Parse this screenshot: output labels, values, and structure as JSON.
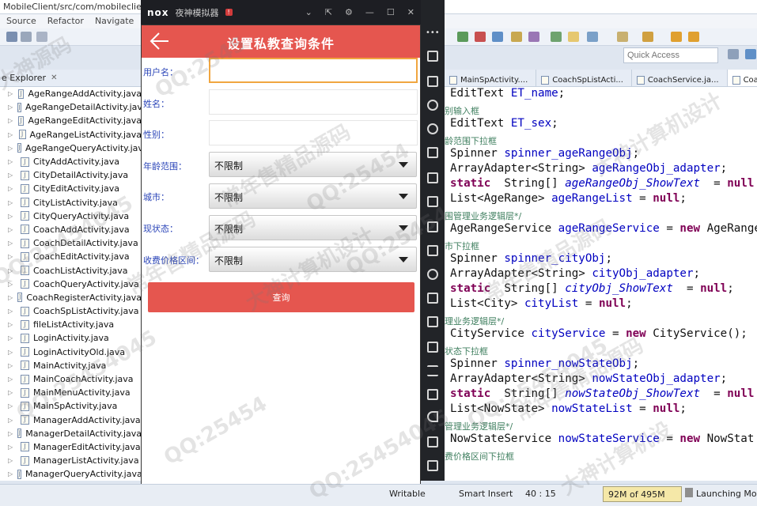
{
  "ide": {
    "title": "MobileClient/src/com/mobileclient/a",
    "menu": [
      "Source",
      "Refactor",
      "Navigate",
      "Se"
    ],
    "quick_access_placeholder": "Quick Access"
  },
  "explorer": {
    "title": "e Explorer",
    "close": "✕",
    "files": [
      "AgeRangeAddActivity.java",
      "AgeRangeDetailActivity.java",
      "AgeRangeEditActivity.java",
      "AgeRangeListActivity.java",
      "AgeRangeQueryActivity.java",
      "CityAddActivity.java",
      "CityDetailActivity.java",
      "CityEditActivity.java",
      "CityListActivity.java",
      "CityQueryActivity.java",
      "CoachAddActivity.java",
      "CoachDetailActivity.java",
      "CoachEditActivity.java",
      "CoachListActivity.java",
      "CoachQueryActivity.java",
      "CoachRegisterActivity.java",
      "CoachSpListActivity.java",
      "fileListActivity.java",
      "LoginActivity.java",
      "LoginActivityOld.java",
      "MainActivity.java",
      "MainCoachActivity.java",
      "MainMenuActivity.java",
      "MainSpActivity.java",
      "ManagerAddActivity.java",
      "ManagerDetailActivity.java",
      "ManagerEditActivity.java",
      "ManagerListActivity.java",
      "ManagerQueryActivity.java"
    ]
  },
  "emulator": {
    "logo": "nox",
    "name": "夜神模拟器",
    "badge": "!"
  },
  "app": {
    "title": "设置私教查询条件",
    "labels": {
      "username": "用户名：",
      "name": "姓名：",
      "sex": "性别：",
      "age_range": "年龄范围：",
      "city": "城市：",
      "now_state": "现状态：",
      "price_range": "收费价格区间："
    },
    "spinners": {
      "age_range": "不限制",
      "city": "不限制",
      "now_state": "不限制",
      "price_range": "不限制"
    },
    "query_button": "查询"
  },
  "editor": {
    "tabs": [
      "MainSpActivity....",
      "CoachSpListActi...",
      "CoachService.ja...",
      "Coach"
    ],
    "lines": [
      {
        "type": "code",
        "text": "EditText ET_name;"
      },
      {
        "type": "comment",
        "text": "别输入框"
      },
      {
        "type": "code",
        "text": "EditText ET_sex;"
      },
      {
        "type": "comment",
        "text": "龄范围下拉框"
      },
      {
        "type": "code",
        "text": "Spinner spinner_ageRangeObj;"
      },
      {
        "type": "code",
        "text": "ArrayAdapter<String> ageRangeObj_adapter;"
      },
      {
        "type": "code",
        "text": "static  String[] ageRangeObj_ShowText  = null"
      },
      {
        "type": "code",
        "text": "List<AgeRange> ageRangeList = null;"
      },
      {
        "type": "comment",
        "text": "围管理业务逻辑层*/"
      },
      {
        "type": "code",
        "text": "AgeRangeService ageRangeService = new AgeRange"
      },
      {
        "type": "comment",
        "text": "市下拉框"
      },
      {
        "type": "code",
        "text": "Spinner spinner_cityObj;"
      },
      {
        "type": "code",
        "text": "ArrayAdapter<String> cityObj_adapter;"
      },
      {
        "type": "code",
        "text": "static  String[] cityObj_ShowText  = null;"
      },
      {
        "type": "code",
        "text": "List<City> cityList = null;"
      },
      {
        "type": "comment",
        "text": "理业务逻辑层*/"
      },
      {
        "type": "code",
        "text": "CityService cityService = new CityService();"
      },
      {
        "type": "comment",
        "text": "状态下拉框"
      },
      {
        "type": "code",
        "text": "Spinner spinner_nowStateObj;"
      },
      {
        "type": "code",
        "text": "ArrayAdapter<String> nowStateObj_adapter;"
      },
      {
        "type": "code",
        "text": "static  String[] nowStateObj_ShowText  = null"
      },
      {
        "type": "code",
        "text": "List<NowState> nowStateList = null;"
      },
      {
        "type": "comment",
        "text": "管理业务逻辑层*/"
      },
      {
        "type": "code",
        "text": "NowStateService nowStateService = new NowStat"
      },
      {
        "type": "comment",
        "text": "费价格区间下拉框"
      }
    ]
  },
  "status": {
    "writable": "Writable",
    "insert": "Smart Insert",
    "position": "40 : 15",
    "heap": "92M of 495M",
    "launching": "Launching Mobi"
  },
  "watermarks": [
    "大神源码",
    "QQ:2545",
    "常年售精品源码",
    "QQ:25454",
    "大神计算机设计",
    "QQ:25454045",
    "常年售精品源码",
    "QQ:25454",
    "QQ:25454045",
    "大神计算机设计",
    "常年售精品源码",
    "QQ:25454",
    "QQ:25454045",
    "常年售精品源码",
    "QQ:25454045",
    "大神计算机设"
  ]
}
